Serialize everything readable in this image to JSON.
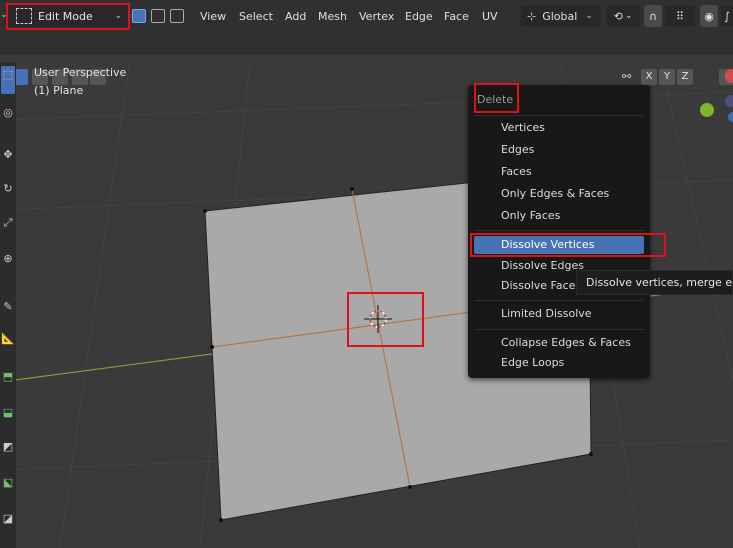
{
  "header": {
    "mode": "Edit Mode",
    "menus": [
      "View",
      "Select",
      "Add",
      "Mesh",
      "Vertex",
      "Edge",
      "Face",
      "UV"
    ],
    "transform_orientation": "Global",
    "axes": [
      "X",
      "Y",
      "Z"
    ]
  },
  "viewport": {
    "view_name": "User Perspective",
    "object_name": "(1) Plane"
  },
  "popup": {
    "title": "Delete",
    "items": [
      "Vertices",
      "Edges",
      "Faces",
      "Only Edges & Faces",
      "Only Faces",
      "Dissolve Vertices",
      "Dissolve Edges",
      "Dissolve Faces",
      "Limited Dissolve",
      "Collapse Edges & Faces",
      "Edge Loops"
    ],
    "highlighted": "Dissolve Vertices"
  },
  "tooltip": {
    "text": "Dissolve vertices, merge edges and faces"
  },
  "colors": {
    "highlight": "#4772b3",
    "annotation": "#e0101a",
    "mesh_face": "#a9a9a9",
    "x_axis": "#b5523c",
    "y_axis": "#7fa33a"
  }
}
